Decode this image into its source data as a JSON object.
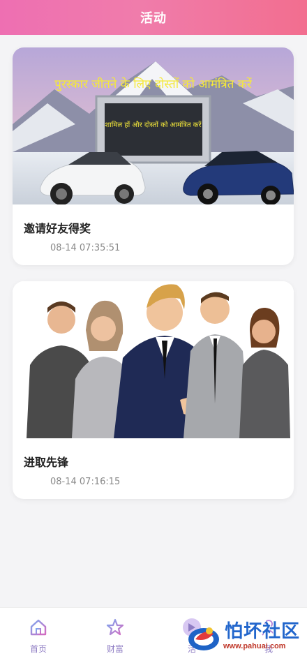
{
  "header": {
    "title": "活动"
  },
  "activities": [
    {
      "title": "邀请好友得奖",
      "time": "08-14 07:35:51",
      "banner_text_1": "पुरस्कार जीतने के लिए दोस्तों को आमंत्रित करें",
      "banner_text_2": "शामिल हों और दोस्तों को आमंत्रित करें"
    },
    {
      "title": "进取先锋",
      "time": "08-14 07:16:15"
    }
  ],
  "tabbar": {
    "items": [
      {
        "label": "首页",
        "icon": "home-icon"
      },
      {
        "label": "财富",
        "icon": "star-icon"
      },
      {
        "label": "活",
        "icon": "activity-icon"
      },
      {
        "label": "我",
        "icon": "profile-icon"
      }
    ]
  },
  "watermark": {
    "brand": "怕坏社区",
    "url": "www.pahuai.com"
  },
  "colors": {
    "header_start": "#ee6fb2",
    "header_end": "#f26e8f",
    "tab_label": "#8e7cc3"
  }
}
